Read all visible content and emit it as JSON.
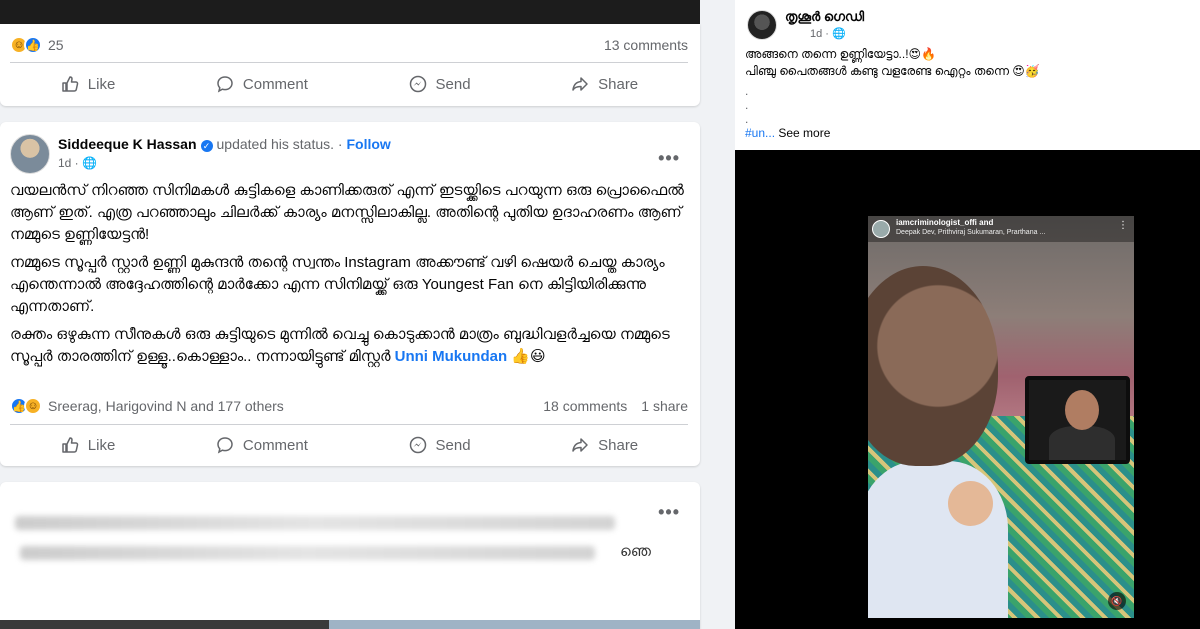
{
  "top_post": {
    "reaction_count": "25",
    "comments": "13 comments"
  },
  "actions": {
    "like": "Like",
    "comment": "Comment",
    "send": "Send",
    "share": "Share"
  },
  "main_post": {
    "author": "Siddeeque K Hassan",
    "status_text": "updated his status.",
    "separator": " · ",
    "follow": "Follow",
    "time": "1d · ",
    "more": "•••",
    "paragraphs": [
      "വയലൻസ് നിറഞ്ഞ സിനിമകൾ കുട്ടികളെ കാണിക്കരുത് എന്ന് ഇടയ്ക്കിടെ പറയുന്ന ഒരു പ്രൊഫൈൽ ആണ് ഇത്. എത്ര പറഞ്ഞാലും ചിലർക്ക് കാര്യം മനസ്സിലാകില്ല. അതിന്റെ പുതിയ ഉദാഹരണം ആണ് നമ്മുടെ ഉണ്ണിയേട്ടൻ!",
      "നമ്മുടെ സൂപ്പർ സ്റ്റാർ ഉണ്ണി മുകുന്ദൻ തന്റെ സ്വന്തം Instagram അക്കൗണ്ട് വഴി ഷെയർ ചെയ്ത കാര്യം എന്തെന്നാൽ അദ്ദേഹത്തിന്റെ മാർക്കോ എന്ന സിനിമയ്ക്ക് ഒരു Youngest Fan നെ കിട്ടിയിരിക്കുന്നു എന്നതാണ്.",
      "രക്തം ഒഴുകുന്ന സീനുകൾ ഒരു കുട്ടിയുടെ മുന്നിൽ വെച്ചു കൊടുക്കാൻ മാത്രം ബുദ്ധിവളർച്ചയെ നമ്മുടെ സൂപ്പർ താരത്തിന് ഉള്ളൂ..കൊള്ളാം.. നന്നായിട്ടുണ്ട് മിസ്റ്റർ"
    ],
    "mention": "Unni Mukundan",
    "emoji_tail": "👍😃",
    "reacted_by": "Sreerag, Harigovind N and 177 others",
    "comments": "18 comments",
    "shares": "1 share"
  },
  "third_post": {
    "more": "•••",
    "partial_word": "ഞെ"
  },
  "side_post": {
    "author": "തൃശൂർ ഗെഡി",
    "time": "1d · ",
    "line1": "അങ്ങനെ തന്നെ ഉണ്ണിയേട്ടാ..!😍🔥",
    "line2": "പിഞ്ചു പൈതങ്ങൾ കണ്ടു വളരേണ്ട ഐറ്റം തന്നെ 😍🥳",
    "dot": ".",
    "hashtag": "#un...",
    "see_more": "See more"
  },
  "video": {
    "ig_user": "iamcriminologist_offi and",
    "ig_sub": "Deepak Dev, Prithviraj Sukumaran, Prarthana ...",
    "ig_more": "⋮",
    "mute": "🔇"
  },
  "colors": {
    "facebook_blue": "#1877f2",
    "muted_text": "#65676b",
    "feed_bg": "#f0f2f5"
  }
}
